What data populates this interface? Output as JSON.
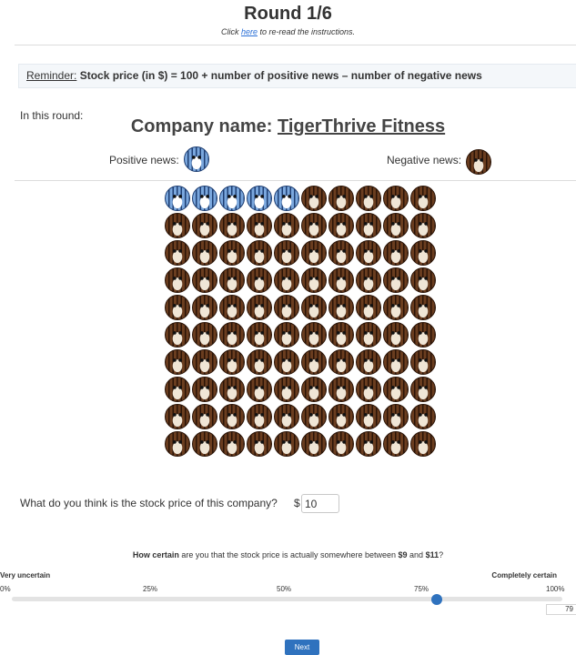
{
  "header": {
    "title": "Round 1/6",
    "subtitle_pre": "Click ",
    "subtitle_link": "here",
    "subtitle_post": " to re-read the instructions."
  },
  "reminder": {
    "label": "Reminder:",
    "text": " Stock price (in $) = 100 + number of positive news – number of negative news"
  },
  "round": {
    "intro": "In this round:",
    "company_label": "Company name: ",
    "company_name": "TigerThrive Fitness",
    "positive_label": "Positive news:",
    "negative_label": "Negative news:",
    "positive_count": 5,
    "negative_count": 95,
    "positive_icon": "tiger-positive-icon",
    "negative_icon": "tiger-negative-icon"
  },
  "price_question": {
    "label": "What do you think is the stock price of this company?",
    "currency": "$",
    "value": "10"
  },
  "certainty": {
    "q_bold": "How certain",
    "q_mid": " are you that the stock price is actually somewhere between ",
    "low": "$9",
    "and": " and ",
    "high": "$11",
    "q_end": "?",
    "left_label": "Very uncertain",
    "right_label": "Completely certain",
    "ticks": [
      "0%",
      "25%",
      "50%",
      "75%",
      "100%"
    ],
    "value": "79"
  },
  "next_label": "Next",
  "colors": {
    "accent": "#2f72be",
    "positive_tiger": "#7aa7dd",
    "negative_tiger": "#6a3d1f"
  }
}
